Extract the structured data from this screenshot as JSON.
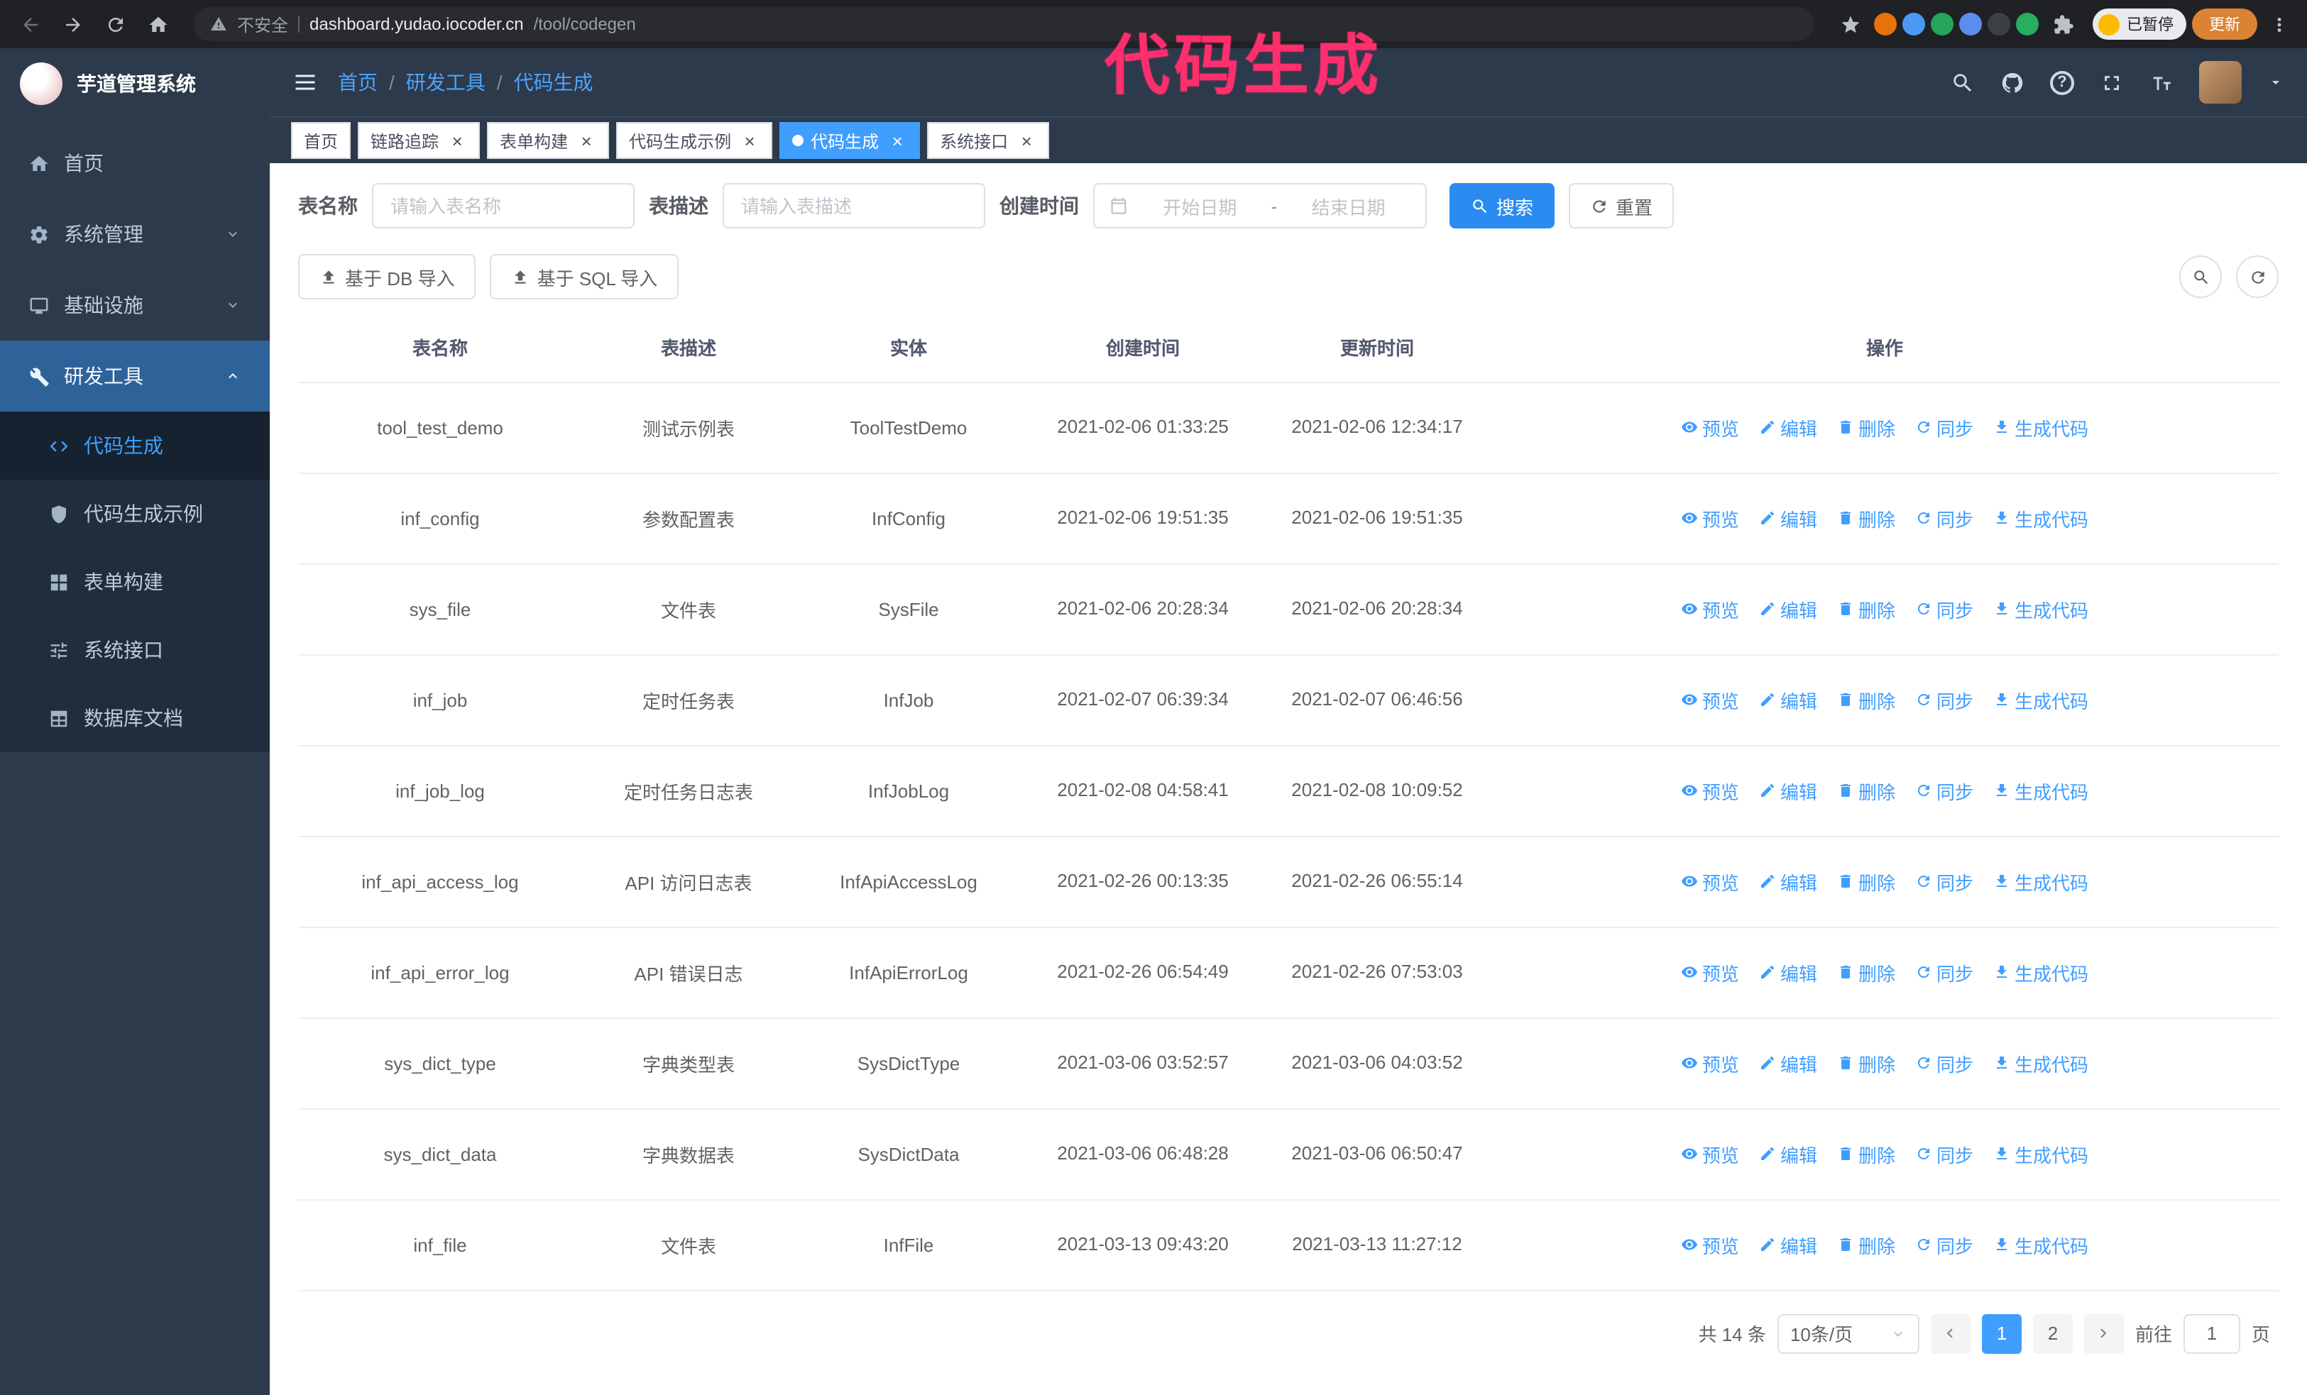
{
  "annotation": {
    "text": "代码生成"
  },
  "colors": {
    "accent": "#409eff",
    "sidebar_bg": "#2d3a4b",
    "submenu_bg": "#1f2d3d",
    "active_parent_bg": "#2d6399",
    "annotation": "#ff2f6e",
    "update_button": "#da8335"
  },
  "browser": {
    "security_label": "不安全",
    "url_host": "dashboard.yudao.iocoder.cn",
    "url_path": "/tool/codegen",
    "paused_badge": "已暂停",
    "update_button": "更新",
    "nav_icons": [
      "back",
      "forward",
      "refresh",
      "home"
    ],
    "right_icons": [
      "bookmark-star",
      "extension-orange",
      "extension-blue",
      "extension-green",
      "extension-people",
      "extension-dark",
      "extension-leaf",
      "extensions-puzzle",
      "profile-paused-chip",
      "update-button",
      "menu-kebab"
    ]
  },
  "sidebar": {
    "logo_title": "芋道管理系统",
    "menu": [
      {
        "key": "home",
        "label": "首页",
        "icon": "home-icon"
      },
      {
        "key": "system",
        "label": "系统管理",
        "icon": "gear-icon",
        "arrow": "down"
      },
      {
        "key": "infra",
        "label": "基础设施",
        "icon": "infra-icon",
        "arrow": "down"
      },
      {
        "key": "devtools",
        "label": "研发工具",
        "icon": "tools-icon",
        "arrow": "up",
        "active": true
      }
    ],
    "submenu": [
      {
        "key": "codegen",
        "label": "代码生成",
        "icon": "code-icon",
        "active": true
      },
      {
        "key": "codegen-example",
        "label": "代码生成示例",
        "icon": "example-icon"
      },
      {
        "key": "form-builder",
        "label": "表单构建",
        "icon": "form-icon"
      },
      {
        "key": "api",
        "label": "系统接口",
        "icon": "api-icon"
      },
      {
        "key": "db-doc",
        "label": "数据库文档",
        "icon": "dbdoc-icon"
      }
    ]
  },
  "navbar": {
    "breadcrumb": [
      "首页",
      "研发工具",
      "代码生成"
    ],
    "icons": [
      "search",
      "github",
      "help",
      "fullscreen",
      "font-size",
      "avatar",
      "caret-down"
    ]
  },
  "tags": [
    {
      "key": "home",
      "label": "首页",
      "closable": false,
      "active": false
    },
    {
      "key": "tracer",
      "label": "链路追踪",
      "closable": true,
      "active": false
    },
    {
      "key": "form-builder",
      "label": "表单构建",
      "closable": true,
      "active": false
    },
    {
      "key": "codegen-example",
      "label": "代码生成示例",
      "closable": true,
      "active": false
    },
    {
      "key": "codegen",
      "label": "代码生成",
      "closable": true,
      "active": true
    },
    {
      "key": "api",
      "label": "系统接口",
      "closable": true,
      "active": false
    }
  ],
  "filters": {
    "table_name_label": "表名称",
    "table_name_placeholder": "请输入表名称",
    "table_desc_label": "表描述",
    "table_desc_placeholder": "请输入表描述",
    "create_time_label": "创建时间",
    "date_start_placeholder": "开始日期",
    "date_separator": "-",
    "date_end_placeholder": "结束日期",
    "search_button": "搜索",
    "reset_button": "重置"
  },
  "toolbar": {
    "import_db": "基于 DB 导入",
    "import_sql": "基于 SQL 导入"
  },
  "table": {
    "columns": [
      "表名称",
      "表描述",
      "实体",
      "创建时间",
      "更新时间",
      "操作"
    ],
    "row_actions": [
      {
        "key": "preview",
        "label": "预览",
        "icon": "eye-icon"
      },
      {
        "key": "edit",
        "label": "编辑",
        "icon": "edit-icon"
      },
      {
        "key": "delete",
        "label": "删除",
        "icon": "delete-icon"
      },
      {
        "key": "sync",
        "label": "同步",
        "icon": "sync-icon"
      },
      {
        "key": "generate",
        "label": "生成代码",
        "icon": "download-icon"
      }
    ],
    "rows": [
      {
        "name": "tool_test_demo",
        "desc": "测试示例表",
        "entity": "ToolTestDemo",
        "created": "2021-02-06 01:33:25",
        "updated": "2021-02-06 12:34:17"
      },
      {
        "name": "inf_config",
        "desc": "参数配置表",
        "entity": "InfConfig",
        "created": "2021-02-06 19:51:35",
        "updated": "2021-02-06 19:51:35"
      },
      {
        "name": "sys_file",
        "desc": "文件表",
        "entity": "SysFile",
        "created": "2021-02-06 20:28:34",
        "updated": "2021-02-06 20:28:34"
      },
      {
        "name": "inf_job",
        "desc": "定时任务表",
        "entity": "InfJob",
        "created": "2021-02-07 06:39:34",
        "updated": "2021-02-07 06:46:56"
      },
      {
        "name": "inf_job_log",
        "desc": "定时任务日志表",
        "entity": "InfJobLog",
        "created": "2021-02-08 04:58:41",
        "updated": "2021-02-08 10:09:52"
      },
      {
        "name": "inf_api_access_log",
        "desc": "API 访问日志表",
        "entity": "InfApiAccessLog",
        "created": "2021-02-26 00:13:35",
        "updated": "2021-02-26 06:55:14"
      },
      {
        "name": "inf_api_error_log",
        "desc": "API 错误日志",
        "entity": "InfApiErrorLog",
        "created": "2021-02-26 06:54:49",
        "updated": "2021-02-26 07:53:03"
      },
      {
        "name": "sys_dict_type",
        "desc": "字典类型表",
        "entity": "SysDictType",
        "created": "2021-03-06 03:52:57",
        "updated": "2021-03-06 04:03:52"
      },
      {
        "name": "sys_dict_data",
        "desc": "字典数据表",
        "entity": "SysDictData",
        "created": "2021-03-06 06:48:28",
        "updated": "2021-03-06 06:50:47"
      },
      {
        "name": "inf_file",
        "desc": "文件表",
        "entity": "InfFile",
        "created": "2021-03-13 09:43:20",
        "updated": "2021-03-13 11:27:12"
      }
    ]
  },
  "pagination": {
    "total": "共 14 条",
    "page_size": "10条/页",
    "pages": [
      "1",
      "2"
    ],
    "active_page": "1",
    "goto_label": "前往",
    "goto_value": "1",
    "goto_suffix": "页"
  }
}
